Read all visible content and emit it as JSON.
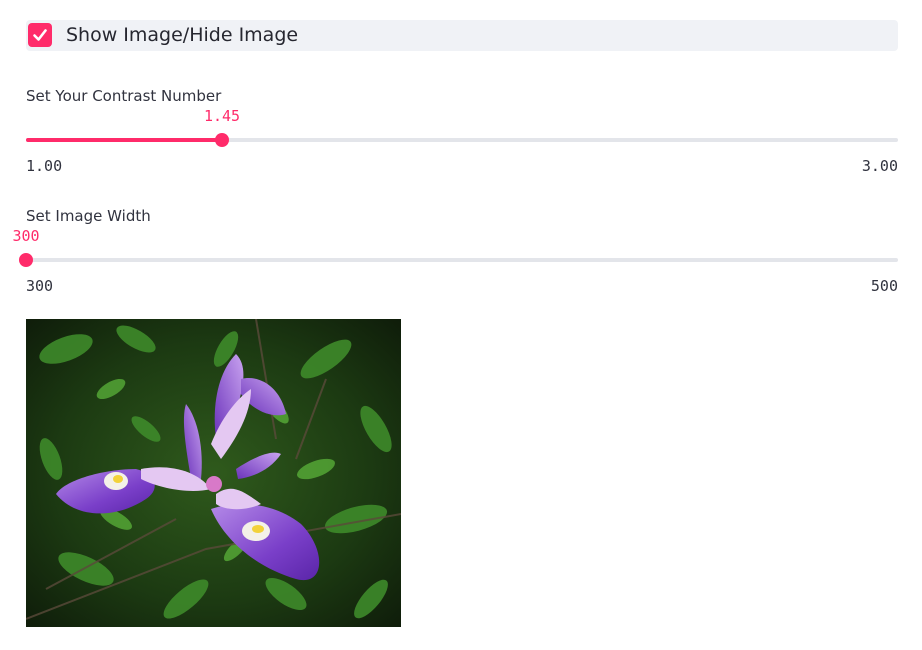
{
  "checkbox": {
    "label": "Show Image/Hide Image",
    "checked": true
  },
  "contrast_slider": {
    "label": "Set Your Contrast Number",
    "value": "1.45",
    "min": "1.00",
    "max": "3.00",
    "fraction": 0.225
  },
  "width_slider": {
    "label": "Set Image Width",
    "value": "300",
    "min": "300",
    "max": "500",
    "fraction": 0.0
  },
  "image": {
    "subject": "purple iris flower"
  },
  "colors": {
    "accent": "#ff2b6a",
    "track": "#e3e5ea",
    "checkbox_bg": "#f0f2f6"
  }
}
